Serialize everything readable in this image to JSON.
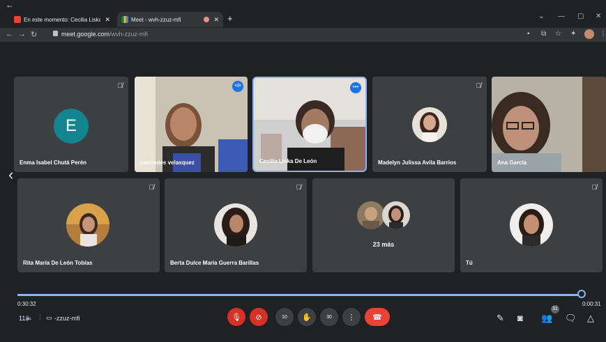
{
  "browser": {
    "tabs": [
      {
        "title": "En este momento: Cecilia Liska D",
        "active": false,
        "icon": "gmail-icon"
      },
      {
        "title": "Meet - wvh-zzuz-mfi",
        "active": true,
        "icon": "meet-icon"
      }
    ],
    "new_tab": "+",
    "url_host": "meet.google.com",
    "url_path": "/wvh-zzuz-mfi"
  },
  "participants_row1": [
    {
      "name": "Enma Isabel Chutá Perén",
      "avatar_letter": "E",
      "muted": true
    },
    {
      "name": "mercedes velasquez",
      "speaking": true
    },
    {
      "name": "Cecilia Liska De León",
      "selected": true
    },
    {
      "name": "Madelyn Julissa Avila Barrios",
      "muted": true
    },
    {
      "name": "Ana García"
    }
  ],
  "participants_row2": [
    {
      "name": "Rita María De León Tobías",
      "muted": true
    },
    {
      "name": "Berta Dulce María Guerra Barillas",
      "muted": true
    },
    {
      "name": "",
      "more_label": "23 más"
    },
    {
      "name": "Tú",
      "muted": true
    }
  ],
  "playback": {
    "elapsed": "0:30:32",
    "remaining": "0:00:31",
    "progress_fraction": 0.99
  },
  "bottom": {
    "time_fragment": "11:",
    "meeting_code_fragment": "-zzuz-mfi",
    "badge_count": "31",
    "cc_label": "10",
    "present_label": "30"
  },
  "colors": {
    "accent": "#8ab4f8",
    "tile": "#3c4043",
    "danger": "#ea4335",
    "avatar_e": "#12858e"
  }
}
